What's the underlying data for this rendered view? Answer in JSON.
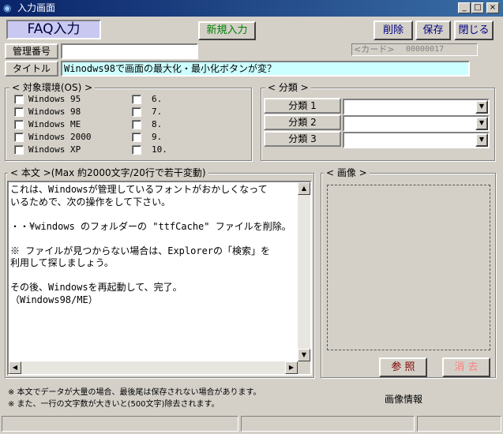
{
  "window": {
    "title": "入力画面",
    "icon": "eye-icon",
    "minimize": "_",
    "maximize": "□",
    "close": "×"
  },
  "header": {
    "faq_label": "FAQ入力",
    "new_button": "新規入力",
    "delete_button": "削除",
    "save_button": "保存",
    "close_button": "閉じる"
  },
  "fields": {
    "manage_no_label": "管理番号",
    "manage_no_value": "",
    "card_label": "<カード>",
    "card_value": "00000017",
    "title_label": "タイトル",
    "title_value": "Winodws98で画面の最大化・最小化ボタンが変？"
  },
  "os_group": {
    "title": "< 対象環境(OS) >",
    "left": [
      "Windows 95",
      "Windows 98",
      "Windows ME",
      "Windows 2000",
      "Windows XP"
    ],
    "right": [
      "6.",
      "7.",
      "8.",
      "9.",
      "10."
    ]
  },
  "category_group": {
    "title": "< 分類 >",
    "items": [
      {
        "label": "分類 1",
        "value": ""
      },
      {
        "label": "分類 2",
        "value": ""
      },
      {
        "label": "分類 3",
        "value": ""
      }
    ]
  },
  "body_group": {
    "title": "< 本文 >(Max 約2000文字/20行で若干変動)",
    "lines": [
      "これは、Windowsが管理しているフォントがおかしくなって",
      "いるためで、次の操作をして下さい。",
      "",
      "・・¥windows のフォルダーの \"ttfCache\" ファイルを削除。",
      "",
      "※ ファイルが見つからない場合は、Explorerの「検索」を",
      "利用して探しましょう。",
      "",
      "その後、Windowsを再起動して、完了。",
      "（Windows98/ME）"
    ]
  },
  "image_group": {
    "title": "< 画像 >",
    "browse_button": "参 照",
    "clear_button": "消 去",
    "info_label": "画像情報"
  },
  "notes": [
    "※ 本文でデータが大量の場合、最後尾は保存されない場合があります。",
    "※ また、一行の文字数が大きいと(500文字)除去されます。"
  ],
  "colors": {
    "title_bg": "#0a246a",
    "title_field_bg": "#ccffff",
    "faq_label_bg": "#c8c8f0",
    "new_button_text": "#008000",
    "delete_text": "#000080",
    "browse_text": "#800000",
    "clear_text": "#ff8080"
  }
}
